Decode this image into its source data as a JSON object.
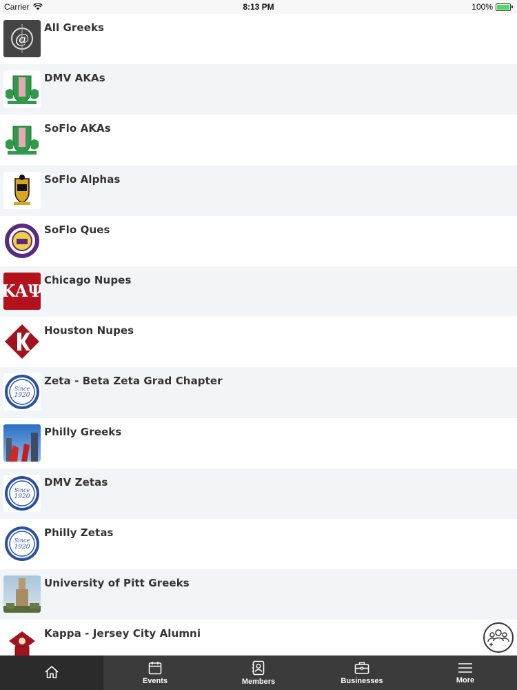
{
  "status_bar": {
    "carrier": "Carrier",
    "time": "8:13 PM",
    "battery": "100%",
    "battery_level": 1.0
  },
  "groups": [
    {
      "name": "All Greeks",
      "icon": "greek-letter-logo-icon"
    },
    {
      "name": "DMV AKAs",
      "icon": "aka-crest-icon"
    },
    {
      "name": "SoFlo AKAs",
      "icon": "aka-crest-icon"
    },
    {
      "name": "SoFlo Alphas",
      "icon": "alpha-crest-icon"
    },
    {
      "name": "SoFlo Ques",
      "icon": "omega-seal-icon"
    },
    {
      "name": "Chicago Nupes",
      "icon": "kappa-letters-icon"
    },
    {
      "name": "Houston Nupes",
      "icon": "kappa-diamond-icon"
    },
    {
      "name": "Zeta - Beta Zeta Grad Chapter",
      "icon": "zeta-seal-icon"
    },
    {
      "name": "Philly Greeks",
      "icon": "city-photo-icon"
    },
    {
      "name": "DMV Zetas",
      "icon": "zeta-seal-icon"
    },
    {
      "name": "Philly Zetas",
      "icon": "zeta-seal-icon"
    },
    {
      "name": "University of Pitt Greeks",
      "icon": "tower-photo-icon"
    },
    {
      "name": "Kappa - Jersey City Alumni",
      "icon": "kappa-crest-icon"
    }
  ],
  "tabs": [
    {
      "label": "",
      "icon": "home-icon",
      "active": true
    },
    {
      "label": "Events",
      "icon": "calendar-icon",
      "active": false
    },
    {
      "label": "Members",
      "icon": "contacts-icon",
      "active": false
    },
    {
      "label": "Businesses",
      "icon": "briefcase-icon",
      "active": false
    },
    {
      "label": "More",
      "icon": "menu-icon",
      "active": false
    }
  ],
  "fab": {
    "icon": "groups-icon"
  },
  "colors": {
    "row_alt": "#f2f5f7",
    "tab_bar": "#3b3b3b",
    "tab_active": "#2b2b2b",
    "text": "#333333",
    "battery": "#4cd964"
  }
}
